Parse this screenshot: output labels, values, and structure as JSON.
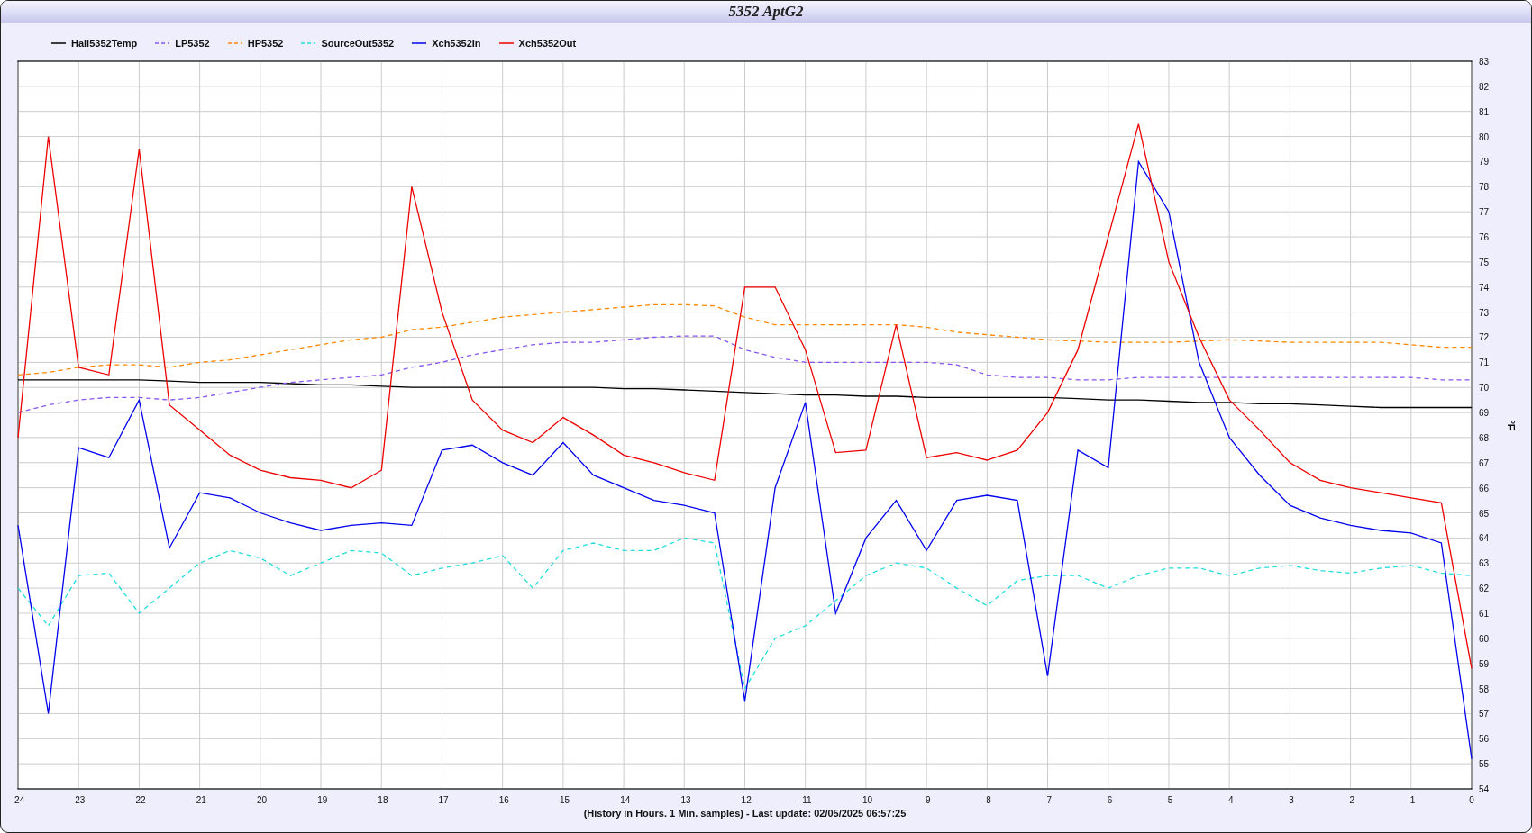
{
  "window": {
    "title": "5352 AptG2"
  },
  "chart_data": {
    "type": "line",
    "xlabel": "(History in Hours. 1 Min. samples) - Last update: 02/05/2025 06:57:25",
    "ylabel": "°F",
    "x": [
      -24,
      -23.5,
      -23,
      -22.5,
      -22,
      -21.5,
      -21,
      -20.5,
      -20,
      -19.5,
      -19,
      -18.5,
      -18,
      -17.5,
      -17,
      -16.5,
      -16,
      -15.5,
      -15,
      -14.5,
      -14,
      -13.5,
      -13,
      -12.5,
      -12,
      -11.5,
      -11,
      -10.5,
      -10,
      -9.5,
      -9,
      -8.5,
      -8,
      -7.5,
      -7,
      -6.5,
      -6,
      -5.5,
      -5,
      -4.5,
      -4,
      -3.5,
      -3,
      -2.5,
      -2,
      -1.5,
      -1,
      -0.5,
      0
    ],
    "grid": true,
    "xlim": [
      -24,
      0
    ],
    "ylim": [
      54,
      83
    ],
    "xticks": [
      -24,
      -23,
      -22,
      -21,
      -20,
      -19,
      -18,
      -17,
      -16,
      -15,
      -14,
      -13,
      -12,
      -11,
      -10,
      -9,
      -8,
      -7,
      -6,
      -5,
      -4,
      -3,
      -2,
      -1,
      0
    ],
    "yticks": [
      54,
      55,
      56,
      57,
      58,
      59,
      60,
      61,
      62,
      63,
      64,
      65,
      66,
      67,
      68,
      69,
      70,
      71,
      72,
      73,
      74,
      75,
      76,
      77,
      78,
      79,
      80,
      81,
      82,
      83
    ],
    "series": [
      {
        "name": "Hall5352Temp",
        "color": "#000000",
        "line_style": "solid",
        "values": [
          70.3,
          70.3,
          70.3,
          70.3,
          70.3,
          70.25,
          70.2,
          70.2,
          70.2,
          70.15,
          70.1,
          70.1,
          70.05,
          70.0,
          70.0,
          70.0,
          70.0,
          70.0,
          70.0,
          70.0,
          69.95,
          69.95,
          69.9,
          69.85,
          69.8,
          69.75,
          69.7,
          69.7,
          69.65,
          69.65,
          69.6,
          69.6,
          69.6,
          69.6,
          69.6,
          69.55,
          69.5,
          69.5,
          69.45,
          69.4,
          69.4,
          69.35,
          69.35,
          69.3,
          69.25,
          69.2,
          69.2,
          69.2,
          69.2
        ]
      },
      {
        "name": "LP5352",
        "color": "#8855ee",
        "line_style": "dashed",
        "values": [
          69.0,
          69.3,
          69.5,
          69.6,
          69.6,
          69.5,
          69.6,
          69.8,
          70.0,
          70.2,
          70.3,
          70.4,
          70.5,
          70.8,
          71.0,
          71.3,
          71.5,
          71.7,
          71.8,
          71.8,
          71.9,
          72.0,
          72.05,
          72.05,
          71.5,
          71.2,
          71.0,
          71.0,
          71.0,
          71.0,
          71.0,
          70.9,
          70.5,
          70.4,
          70.4,
          70.3,
          70.3,
          70.4,
          70.4,
          70.4,
          70.4,
          70.4,
          70.4,
          70.4,
          70.4,
          70.4,
          70.4,
          70.3,
          70.3
        ]
      },
      {
        "name": "HP5352",
        "color": "#ff8800",
        "line_style": "dashed",
        "values": [
          70.5,
          70.6,
          70.8,
          70.9,
          70.9,
          70.8,
          71.0,
          71.1,
          71.3,
          71.5,
          71.7,
          71.9,
          72.0,
          72.3,
          72.4,
          72.6,
          72.8,
          72.9,
          73.0,
          73.1,
          73.2,
          73.3,
          73.3,
          73.25,
          72.8,
          72.5,
          72.5,
          72.5,
          72.5,
          72.5,
          72.4,
          72.2,
          72.1,
          72.0,
          71.9,
          71.85,
          71.8,
          71.8,
          71.8,
          71.85,
          71.9,
          71.85,
          71.8,
          71.8,
          71.8,
          71.8,
          71.7,
          71.6,
          71.6
        ]
      },
      {
        "name": "SourceOut5352",
        "color": "#22dddd",
        "line_style": "dashed",
        "values": [
          62.0,
          60.5,
          62.5,
          62.6,
          61.0,
          62.0,
          63.0,
          63.5,
          63.2,
          62.5,
          63.0,
          63.5,
          63.4,
          62.5,
          62.8,
          63.0,
          63.3,
          62.0,
          63.5,
          63.8,
          63.5,
          63.5,
          64.0,
          63.8,
          58.0,
          60.0,
          60.5,
          61.5,
          62.5,
          63.0,
          62.8,
          62.0,
          61.3,
          62.3,
          62.5,
          62.5,
          62.0,
          62.5,
          62.8,
          62.8,
          62.5,
          62.8,
          62.9,
          62.7,
          62.6,
          62.8,
          62.9,
          62.6,
          62.5
        ]
      },
      {
        "name": "Xch5352In",
        "color": "#0000ee",
        "line_style": "solid",
        "values": [
          64.5,
          57.0,
          67.6,
          67.2,
          69.5,
          63.6,
          65.8,
          65.6,
          65.0,
          64.6,
          64.3,
          64.5,
          64.6,
          64.5,
          67.5,
          67.7,
          67.0,
          66.5,
          67.8,
          66.5,
          66.0,
          65.5,
          65.3,
          65.0,
          57.5,
          66.0,
          69.4,
          61.0,
          64.0,
          65.5,
          63.5,
          65.5,
          65.7,
          65.5,
          58.5,
          67.5,
          66.8,
          79.0,
          77.0,
          71.0,
          68.0,
          66.5,
          65.3,
          64.8,
          64.5,
          64.3,
          64.2,
          63.8,
          55.2
        ]
      },
      {
        "name": "Xch5352Out",
        "color": "#ee0000",
        "line_style": "solid",
        "values": [
          68.0,
          80.0,
          70.8,
          70.5,
          79.5,
          69.3,
          68.3,
          67.3,
          66.7,
          66.4,
          66.3,
          66.0,
          66.7,
          78.0,
          73.0,
          69.5,
          68.3,
          67.8,
          68.8,
          68.1,
          67.3,
          67.0,
          66.6,
          66.3,
          74.0,
          74.0,
          71.5,
          67.4,
          67.5,
          72.5,
          67.2,
          67.4,
          67.1,
          67.5,
          69.0,
          71.5,
          76.0,
          80.5,
          75.0,
          72.0,
          69.5,
          68.3,
          67.0,
          66.3,
          66.0,
          65.8,
          65.6,
          65.4,
          58.8
        ]
      }
    ]
  }
}
